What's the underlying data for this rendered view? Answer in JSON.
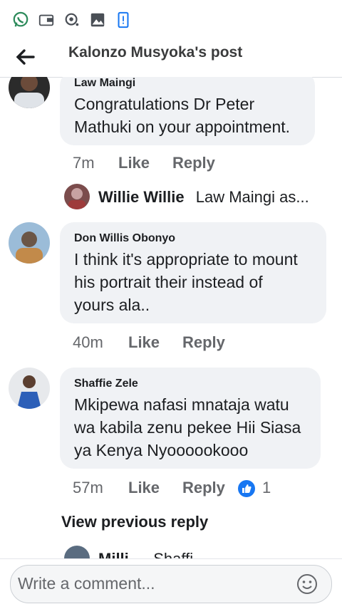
{
  "header": {
    "title": "Kalonzo Musyoka's post"
  },
  "icons": {
    "status": [
      "whatsapp-icon",
      "wallet-icon",
      "sync-icon",
      "gallery-icon",
      "phone-icon"
    ],
    "back": "back-arrow-icon",
    "emoji": "emoji-icon",
    "like": "like-thumb-icon"
  },
  "comments": [
    {
      "author": "Law Maingi",
      "text_lines": [
        "Congratulations Dr Peter",
        "Mathuki on your appointment."
      ],
      "time": "7m",
      "like": "Like",
      "reply": "Reply"
    },
    {
      "author": "Don Willis Obonyo",
      "text_lines": [
        "I think it's appropriate to mount",
        "his portrait their instead of",
        "yours ala.."
      ],
      "time": "40m",
      "like": "Like",
      "reply": "Reply"
    },
    {
      "author": "Shaffie Zele",
      "text_lines": [
        "Mkipewa nafasi mnataja watu",
        "wa kabila zenu pekee Hii Siasa",
        "ya Kenya Nyoooookooo"
      ],
      "time": "57m",
      "like": "Like",
      "reply": "Reply",
      "reactions": "1"
    }
  ],
  "replies": [
    {
      "author": "Willie Willie",
      "preview": "Law Maingi as..."
    },
    {
      "author": "Milli...",
      "preview": "Shaffi..."
    }
  ],
  "view_previous": "View previous reply",
  "composer": {
    "placeholder": "Write a comment..."
  },
  "colors": {
    "accent": "#1877f2",
    "bubble": "#f0f2f5",
    "meta": "#65676b"
  }
}
